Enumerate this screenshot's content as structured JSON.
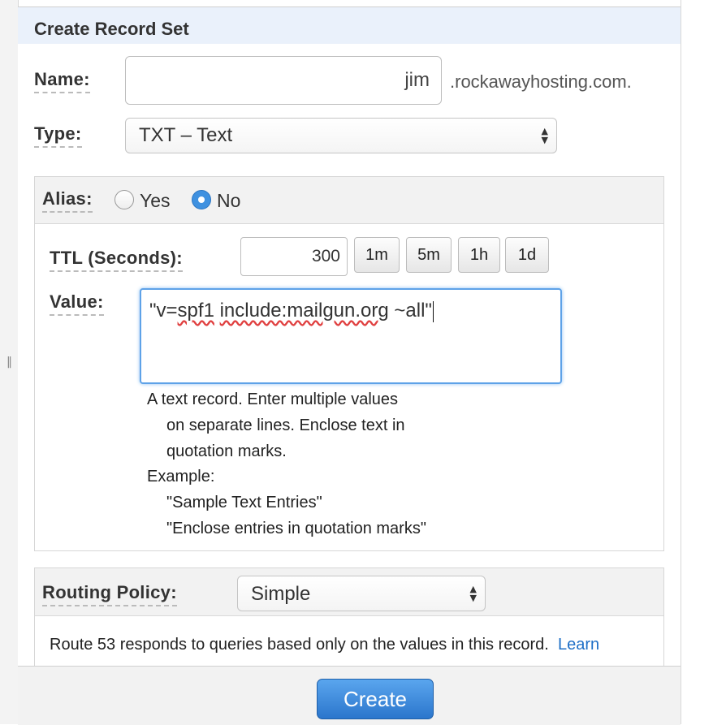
{
  "panel": {
    "title": "Create Record Set"
  },
  "name": {
    "label": "Name:",
    "value": "jim",
    "suffix": ".rockawayhosting.com."
  },
  "type": {
    "label": "Type:",
    "selected": "TXT – Text"
  },
  "alias": {
    "label": "Alias:",
    "yes_label": "Yes",
    "no_label": "No",
    "selected": "No"
  },
  "ttl": {
    "label": "TTL (Seconds):",
    "value": "300",
    "buttons": [
      "1m",
      "5m",
      "1h",
      "1d"
    ]
  },
  "value": {
    "label": "Value:",
    "text_part1": "\"v=",
    "spell1": "spf1",
    "space": " ",
    "spell2": "include:mailgun.org",
    "text_part2": " ~all\""
  },
  "help": {
    "line1": "A text record. Enter multiple values",
    "line2": "on separate lines. Enclose text in",
    "line3": "quotation marks.",
    "example_label": "Example:",
    "example1": "\"Sample Text Entries\"",
    "example2": "\"Enclose entries in quotation marks\""
  },
  "routing": {
    "label": "Routing Policy:",
    "selected": "Simple",
    "description": "Route 53 responds to queries based only on the values in this record.",
    "learn_more": "Learn"
  },
  "footer": {
    "create_label": "Create"
  },
  "colors": {
    "accent": "#3f91e0",
    "header_bg": "#eaf1fb",
    "link": "#1e6fc7"
  }
}
